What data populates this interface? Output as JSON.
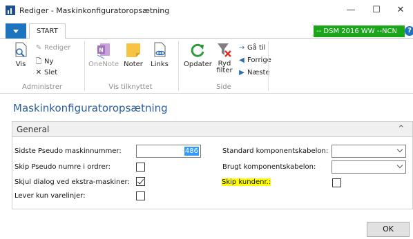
{
  "window": {
    "title": "Rediger - Maskinkonfiguratoropsætning",
    "minimize": "—",
    "maximize": "☐",
    "close": "✕"
  },
  "tabs": {
    "start": "START",
    "company": "-- DSM 2016 WW --NCN",
    "help": "?"
  },
  "ribbon": {
    "administrer": {
      "label": "Administrer",
      "vis": "Vis",
      "rediger": "Rediger",
      "ny": "Ny",
      "slet": "Slet"
    },
    "vis_tilknyttet": {
      "label": "Vis tilknyttet",
      "onenote": "OneNote",
      "noter": "Noter",
      "links": "Links"
    },
    "side": {
      "label": "Side",
      "opdater": "Opdater",
      "ryd_filter_1": "Ryd",
      "ryd_filter_2": "filter",
      "ga_til": "Gå til",
      "forrige": "Forrige",
      "naeste": "Næste"
    }
  },
  "page": {
    "title": "Maskinkonfiguratoropsætning",
    "group": "General",
    "fields": {
      "sidste_pseudo_label": "Sidste Pseudo maskinnummer:",
      "sidste_pseudo_value": "486",
      "skip_pseudo_label": "Skip Pseudo numre i ordrer:",
      "skip_pseudo_checked": false,
      "skjul_dialog_label": "Skjul dialog ved ekstra-maskiner:",
      "skjul_dialog_checked": true,
      "lever_kun_label": "Lever kun varelinjer:",
      "lever_kun_checked": false,
      "standard_komp_label": "Standard komponentskabelon:",
      "standard_komp_value": "",
      "brugt_komp_label": "Brugt komponentskabelon:",
      "brugt_komp_value": "",
      "skip_kundenr_label": "Skip kundenr.:",
      "skip_kundenr_checked": false
    }
  },
  "footer": {
    "ok": "OK"
  },
  "colors": {
    "accent": "#1e73be",
    "company_badge": "#1aa51a",
    "page_title": "#2a5f9e",
    "highlight": "#ffff00"
  }
}
